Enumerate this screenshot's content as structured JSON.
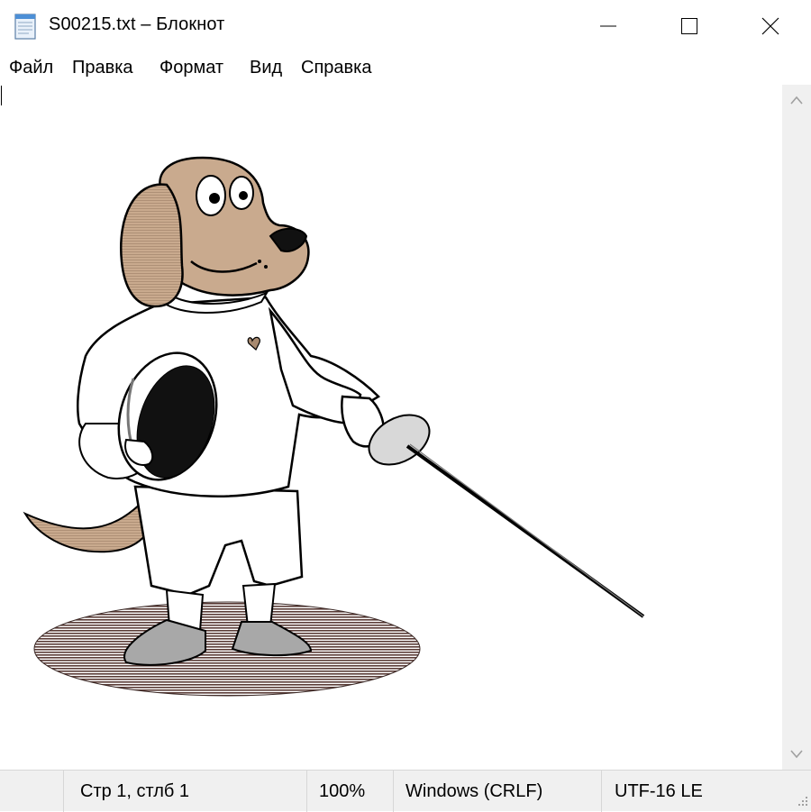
{
  "window": {
    "title": "S00215.txt – Блокнот",
    "icon": "notepad-icon",
    "controls": [
      "minimize-icon",
      "maximize-icon",
      "close-icon"
    ]
  },
  "menu": {
    "items": [
      {
        "label": "Файл"
      },
      {
        "label": "Правка"
      },
      {
        "label": "Формат"
      },
      {
        "label": "Вид"
      },
      {
        "label": "Справка"
      }
    ]
  },
  "editor": {
    "content": "ASCII-art cartoon: dog fencer holding a fencing mask and a foil",
    "colors": {
      "fur": "#c8a88b",
      "fur_shade": "#a3846a",
      "shadow": "#6e4f48",
      "outline": "#000000",
      "shoe": "#9a9a9a"
    }
  },
  "status": {
    "position": "Стр 1, стлб 1",
    "zoom": "100%",
    "line_endings": "Windows (CRLF)",
    "encoding": "UTF-16 LE"
  }
}
